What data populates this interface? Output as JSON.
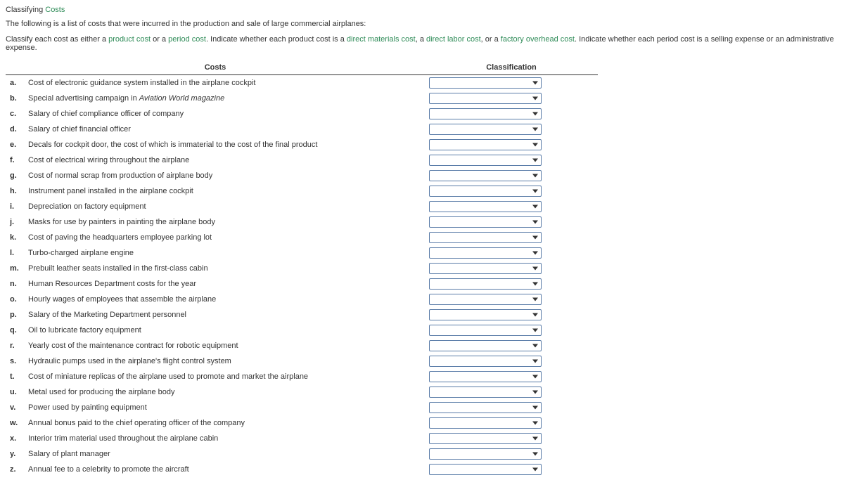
{
  "title": {
    "prefix": "Classifying ",
    "highlight": "Costs"
  },
  "intro": "The following is a list of costs that were incurred in the production and sale of large commercial airplanes:",
  "instructions": {
    "p1": "Classify each cost as either a ",
    "g1": "product cost",
    "p2": " or a ",
    "g2": "period cost",
    "p3": ". Indicate whether each product cost is a ",
    "g3": "direct materials cost",
    "p4": ", a ",
    "g4": "direct labor cost",
    "p5": ", or a ",
    "g5": "factory overhead cost",
    "p6": ". Indicate whether each period cost is a selling expense or an administrative expense."
  },
  "headers": {
    "costs": "Costs",
    "classification": "Classification"
  },
  "rows": [
    {
      "letter": "a.",
      "desc": "Cost of electronic guidance system installed in the airplane cockpit"
    },
    {
      "letter": "b.",
      "desc_pre": "Special advertising campaign in ",
      "desc_italic": "Aviation World magazine"
    },
    {
      "letter": "c.",
      "desc": "Salary of chief compliance officer of company"
    },
    {
      "letter": "d.",
      "desc": "Salary of chief financial officer"
    },
    {
      "letter": "e.",
      "desc": "Decals for cockpit door, the cost of which is immaterial to the cost of the final product"
    },
    {
      "letter": "f.",
      "desc": "Cost of electrical wiring throughout the airplane"
    },
    {
      "letter": "g.",
      "desc": "Cost of normal scrap from production of airplane body"
    },
    {
      "letter": "h.",
      "desc": "Instrument panel installed in the airplane cockpit"
    },
    {
      "letter": "i.",
      "desc": "Depreciation on factory equipment"
    },
    {
      "letter": "j.",
      "desc": "Masks for use by painters in painting the airplane body"
    },
    {
      "letter": "k.",
      "desc": "Cost of paving the headquarters employee parking lot"
    },
    {
      "letter": "l.",
      "desc": "Turbo-charged airplane engine"
    },
    {
      "letter": "m.",
      "desc": "Prebuilt leather seats installed in the first-class cabin"
    },
    {
      "letter": "n.",
      "desc": "Human Resources Department costs for the year"
    },
    {
      "letter": "o.",
      "desc": "Hourly wages of employees that assemble the airplane"
    },
    {
      "letter": "p.",
      "desc": "Salary of the Marketing Department personnel"
    },
    {
      "letter": "q.",
      "desc": "Oil to lubricate factory equipment"
    },
    {
      "letter": "r.",
      "desc": "Yearly cost of the maintenance contract for robotic equipment"
    },
    {
      "letter": "s.",
      "desc": "Hydraulic pumps used in the airplane's flight control system"
    },
    {
      "letter": "t.",
      "desc": "Cost of miniature replicas of the airplane used to promote and market the airplane"
    },
    {
      "letter": "u.",
      "desc": "Metal used for producing the airplane body"
    },
    {
      "letter": "v.",
      "desc": "Power used by painting equipment"
    },
    {
      "letter": "w.",
      "desc": "Annual bonus paid to the chief operating officer of the company"
    },
    {
      "letter": "x.",
      "desc": "Interior trim material used throughout the airplane cabin"
    },
    {
      "letter": "y.",
      "desc": "Salary of plant manager"
    },
    {
      "letter": "z.",
      "desc": "Annual fee to a celebrity to promote the aircraft"
    }
  ]
}
